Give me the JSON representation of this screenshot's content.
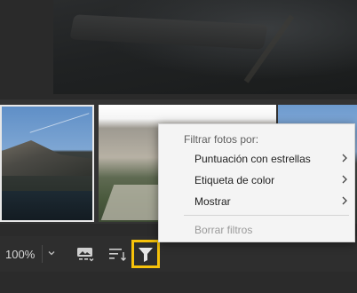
{
  "zoom": {
    "value": "100%"
  },
  "filter_menu": {
    "header": "Filtrar fotos por:",
    "items": [
      {
        "label": "Puntuación con estrellas",
        "has_submenu": true
      },
      {
        "label": "Etiqueta de color",
        "has_submenu": true
      },
      {
        "label": "Mostrar",
        "has_submenu": true
      }
    ],
    "clear_label": "Borrar filtros"
  },
  "toolbar": {
    "buttons": [
      {
        "icon": "image-info-icon"
      },
      {
        "icon": "sort-icon"
      },
      {
        "icon": "filter-icon",
        "highlighted": true
      }
    ]
  },
  "colors": {
    "highlight": "#f7c20a",
    "menu_bg": "#f4f4f4",
    "app_bg": "#2b2b2b"
  }
}
